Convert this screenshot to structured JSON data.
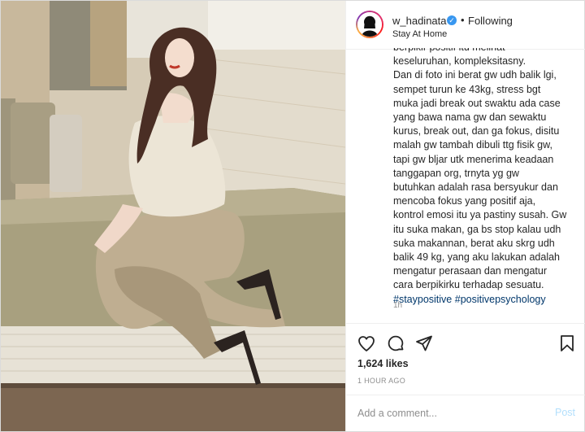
{
  "post": {
    "username": "w_hadinata",
    "verified_icon": "verified-badge-icon",
    "separator": "•",
    "follow_status": "Following",
    "location": "Stay At Home",
    "caption_lines": "berpikir positif itu melihat\nkeseluruhan, kompleksitasny.\nDan di foto ini berat gw udh balik lgi,\nsempet turun ke 43kg, stress bgt\nmuka jadi break out swaktu ada case\nyang bawa nama gw dan sewaktu\nkurus, break out, dan ga fokus, disitu\nmalah gw tambah dibuli ttg fisik gw,\ntapi gw bljar utk menerima keadaan\ntanggapan org, trnyta yg gw\nbutuhkan adalah rasa bersyukur dan\nmencoba fokus yang positif aja,\nkontrol emosi itu ya pastiny susah. Gw\nitu suka makan, ga bs stop kalau udh\nsuka makannan, berat aku skrg udh\nbalik 49 kg, yang aku lakukan adalah\nmengatur perasaan dan mengatur\ncara berpikirku terhadap sesuatu.",
    "hashtags": [
      "#staypositive",
      "#positivepsychology"
    ],
    "caption_time": "1h",
    "likes": "1,624 likes",
    "posted": "1 HOUR AGO"
  },
  "actions": {
    "like_icon": "heart-icon",
    "comment_icon": "comment-icon",
    "share_icon": "paper-plane-icon",
    "save_icon": "bookmark-icon"
  },
  "comment": {
    "placeholder": "Add a comment...",
    "post_label": "Post"
  },
  "colors": {
    "link": "#00376b",
    "muted": "#8e8e8e",
    "post_disabled": "#b2dffc",
    "verified": "#3897f0"
  }
}
